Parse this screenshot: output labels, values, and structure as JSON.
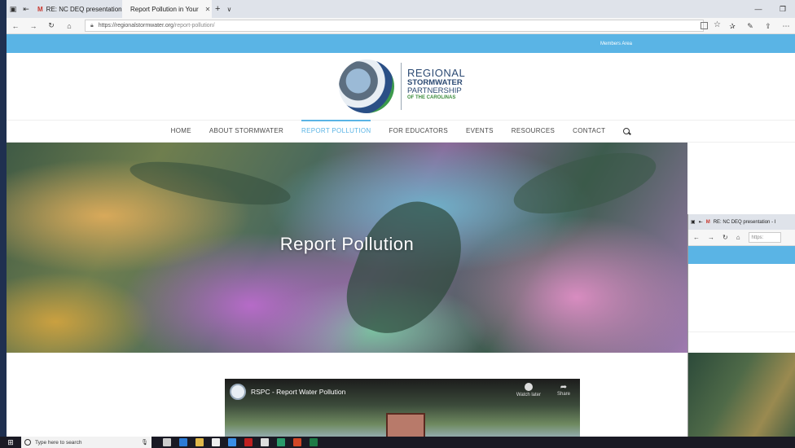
{
  "browser": {
    "tabs": [
      {
        "icon": "mail-icon",
        "label": "RE: NC DEQ presentation - I"
      },
      {
        "icon": "globe-icon",
        "label": "Report Pollution in Your",
        "active": true
      }
    ],
    "url_domain": "https://regionalstormwater.org",
    "url_path": "/report-pollution/"
  },
  "site": {
    "topbar_link": "Members Area",
    "logo": {
      "line1": "REGIONAL",
      "line2": "STORMWATER",
      "line3": "PARTNERSHIP",
      "line4": "OF THE CAROLINAS"
    },
    "nav": [
      {
        "label": "HOME"
      },
      {
        "label": "ABOUT STORMWATER"
      },
      {
        "label": "REPORT POLLUTION",
        "active": true
      },
      {
        "label": "FOR EDUCATORS"
      },
      {
        "label": "EVENTS"
      },
      {
        "label": "RESOURCES"
      },
      {
        "label": "CONTACT"
      }
    ],
    "hero_title": "Report Pollution",
    "video": {
      "title": "RSPC - Report Water Pollution",
      "watch_later": "Watch later",
      "share": "Share"
    }
  },
  "second_window": {
    "tab_label": "RE: NC DEQ presentation - I",
    "url_partial": "https:"
  },
  "taskbar": {
    "search_placeholder": "Type here to search"
  },
  "colors": {
    "accent": "#5ab4e5",
    "logo_navy": "#2c4a73",
    "logo_green": "#3c8c3c"
  }
}
